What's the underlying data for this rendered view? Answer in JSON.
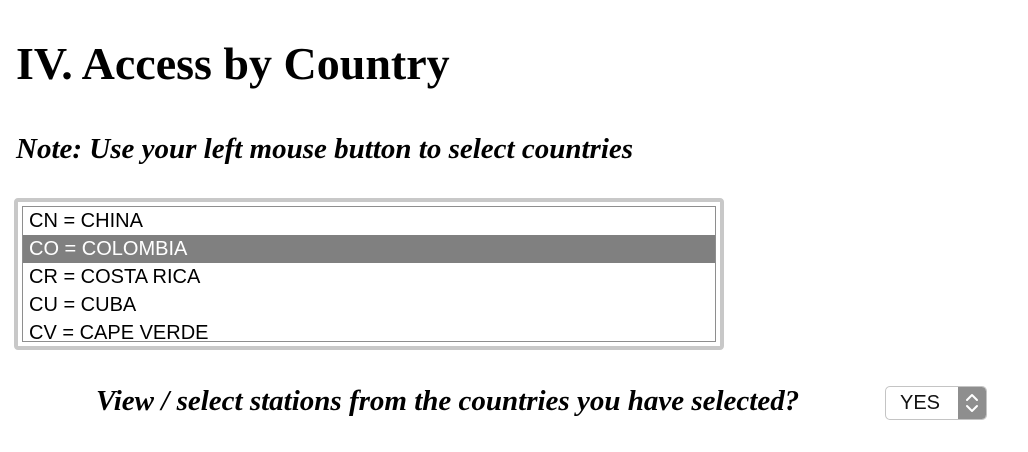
{
  "section": {
    "title": "IV. Access by Country",
    "note": "Note: Use your left mouse button to select countries"
  },
  "country_list": {
    "options": [
      {
        "label": "CN = CHINA",
        "selected": false
      },
      {
        "label": "CO = COLOMBIA",
        "selected": true
      },
      {
        "label": "CR = COSTA RICA",
        "selected": false
      },
      {
        "label": "CU = CUBA",
        "selected": false
      },
      {
        "label": "CV = CAPE VERDE",
        "selected": false
      }
    ],
    "selected_color": "#808080"
  },
  "stations_prompt": {
    "question": "View / select stations from the countries you have selected?",
    "select_value": "YES",
    "arrows_icon": "up-down-chevron-icon"
  }
}
